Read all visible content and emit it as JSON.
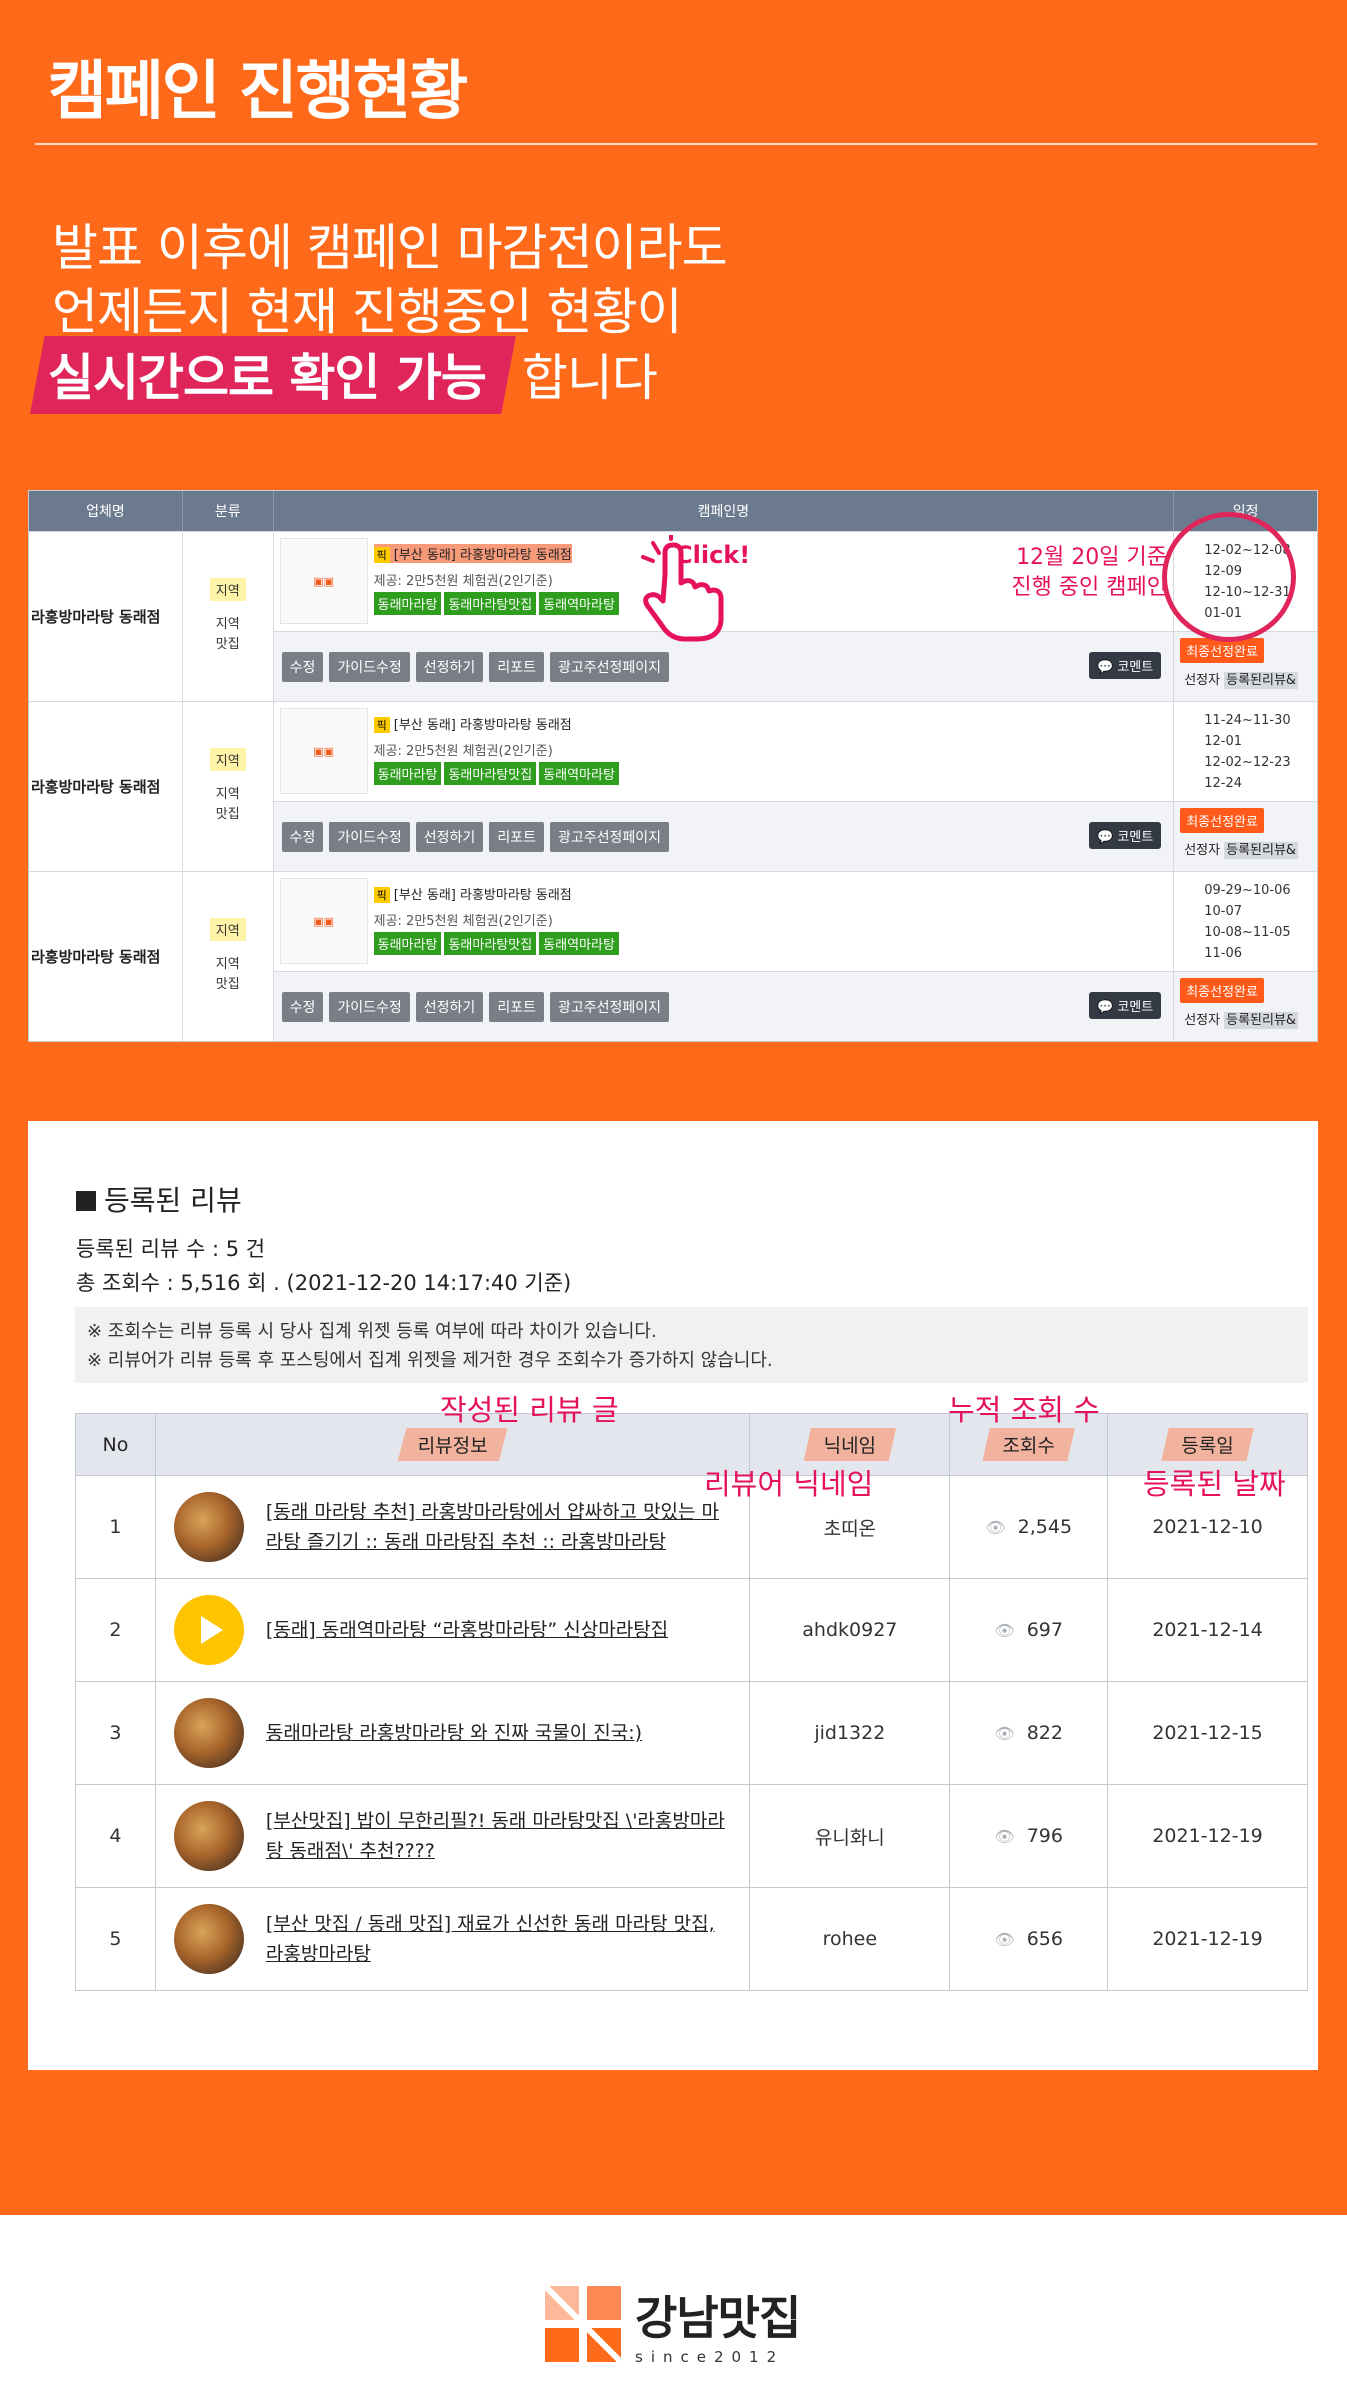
{
  "hero": {
    "title": "캠페인 진행현황",
    "line1": "발표 이후에 캠페인 마감전이라도",
    "line2": "언제든지 현재 진행중인 현황이",
    "line3_highlight": "실시간으로 확인 가능",
    "line3_rest": "합니다",
    "bg_color": "#ff6a1a",
    "accent_color": "#e0255b"
  },
  "campaign": {
    "headers": [
      "업체명",
      "분류",
      "캠페인명",
      "일정"
    ],
    "click_label": "Click!",
    "note_line1": "12월 20일 기준",
    "note_line2": "진행 중인 캠페인",
    "rows": [
      {
        "business": "라홍방마라탕 동래점",
        "cat_tag": "지역",
        "cat_plain": "지역\n맛집",
        "pick": "픽",
        "title": "[부산 동래] 라홍방마라탕 동래점",
        "sub": "제공: 2만5천원 체험권(2인기준)",
        "chips": [
          "동래마라탕",
          "동래마라탕맛집",
          "동래역마라탕"
        ],
        "buttons": [
          "수정",
          "가이드수정",
          "선정하기",
          "리포트",
          "광고주선정페이지"
        ],
        "comment": "코멘트",
        "dates": [
          "12-02~12-08",
          "12-09",
          "12-10~12-31",
          "01-01"
        ],
        "done": "최종선정완료",
        "sel": "선정자",
        "reg": "등록된리뷰&"
      },
      {
        "business": "라홍방마라탕 동래점",
        "cat_tag": "지역",
        "cat_plain": "지역\n맛집",
        "pick": "픽",
        "title": "[부산 동래] 라홍방마라탕 동래점",
        "sub": "제공: 2만5천원 체험권(2인기준)",
        "chips": [
          "동래마라탕",
          "동래마라탕맛집",
          "동래역마라탕"
        ],
        "buttons": [
          "수정",
          "가이드수정",
          "선정하기",
          "리포트",
          "광고주선정페이지"
        ],
        "comment": "코멘트",
        "dates": [
          "11-24~11-30",
          "12-01",
          "12-02~12-23",
          "12-24"
        ],
        "done": "최종선정완료",
        "sel": "선정자",
        "reg": "등록된리뷰&"
      },
      {
        "business": "라홍방마라탕 동래점",
        "cat_tag": "지역",
        "cat_plain": "지역\n맛집",
        "pick": "픽",
        "title": "[부산 동래] 라홍방마라탕 동래점",
        "sub": "제공: 2만5천원 체험권(2인기준)",
        "chips": [
          "동래마라탕",
          "동래마라탕맛집",
          "동래역마라탕"
        ],
        "buttons": [
          "수정",
          "가이드수정",
          "선정하기",
          "리포트",
          "광고주선정페이지"
        ],
        "comment": "코멘트",
        "dates": [
          "09-29~10-06",
          "10-07",
          "10-08~11-05",
          "11-06"
        ],
        "done": "최종선정완료",
        "sel": "선정자",
        "reg": "등록된리뷰&"
      }
    ]
  },
  "reviews": {
    "heading": "등록된 리뷰",
    "count_line": "등록된 리뷰 수 : 5 건",
    "views_line": "총 조회수 : 5,516 회 . (2021-12-20 14:17:40 기준)",
    "note1": "※ 조회수는 리뷰 등록 시 당사 집계 위젯 등록 여부에 따라 차이가 있습니다.",
    "note2": "※ 리뷰어가 리뷰 등록 후 포스팅에서 집계 위젯을 제거한 경우 조회수가 증가하지 않습니다.",
    "columns": [
      "No",
      "리뷰정보",
      "닉네임",
      "조회수",
      "등록일"
    ],
    "annotations": {
      "info": "작성된 리뷰 글",
      "views": "누적 조회 수",
      "nick": "리뷰어 닉네임",
      "date": "등록된 날짜"
    },
    "rows": [
      {
        "no": "1",
        "title": "[동래 마라탕 추천] 라홍방마라탕에서 얍싸하고 맛있는 마라탕 즐기기 :: 동래 마라탕집 추천 :: 라홍방마라탕",
        "nick": "초띠온",
        "views": "2,545",
        "date": "2021-12-10",
        "thumb": "food-photo"
      },
      {
        "no": "2",
        "title": "[동래] 동래역마라탕 “라홍방마라탕” 신상마라탕집",
        "nick": "ahdk0927",
        "views": "697",
        "date": "2021-12-14",
        "thumb": "play-icon"
      },
      {
        "no": "3",
        "title": "동래마라탕 라홍방마라탕 와 진짜 국물이 진국:)",
        "nick": "jid1322",
        "views": "822",
        "date": "2021-12-15",
        "thumb": "food-photo"
      },
      {
        "no": "4",
        "title": "[부산맛집] 밥이 무한리필?! 동래 마라탕맛집 \\'라홍방마라탕 동래점\\' 추천????",
        "nick": "유니화니",
        "views": "796",
        "date": "2021-12-19",
        "thumb": "food-photo"
      },
      {
        "no": "5",
        "title": "[부산 맛집 / 동래 맛집] 재료가 신선한 동래 마라탕 맛집, 라홍방마라탕",
        "nick": "rohee",
        "views": "656",
        "date": "2021-12-19",
        "thumb": "food-photo"
      }
    ]
  },
  "footer": {
    "brand": "강남맛집",
    "since": "since2012"
  }
}
